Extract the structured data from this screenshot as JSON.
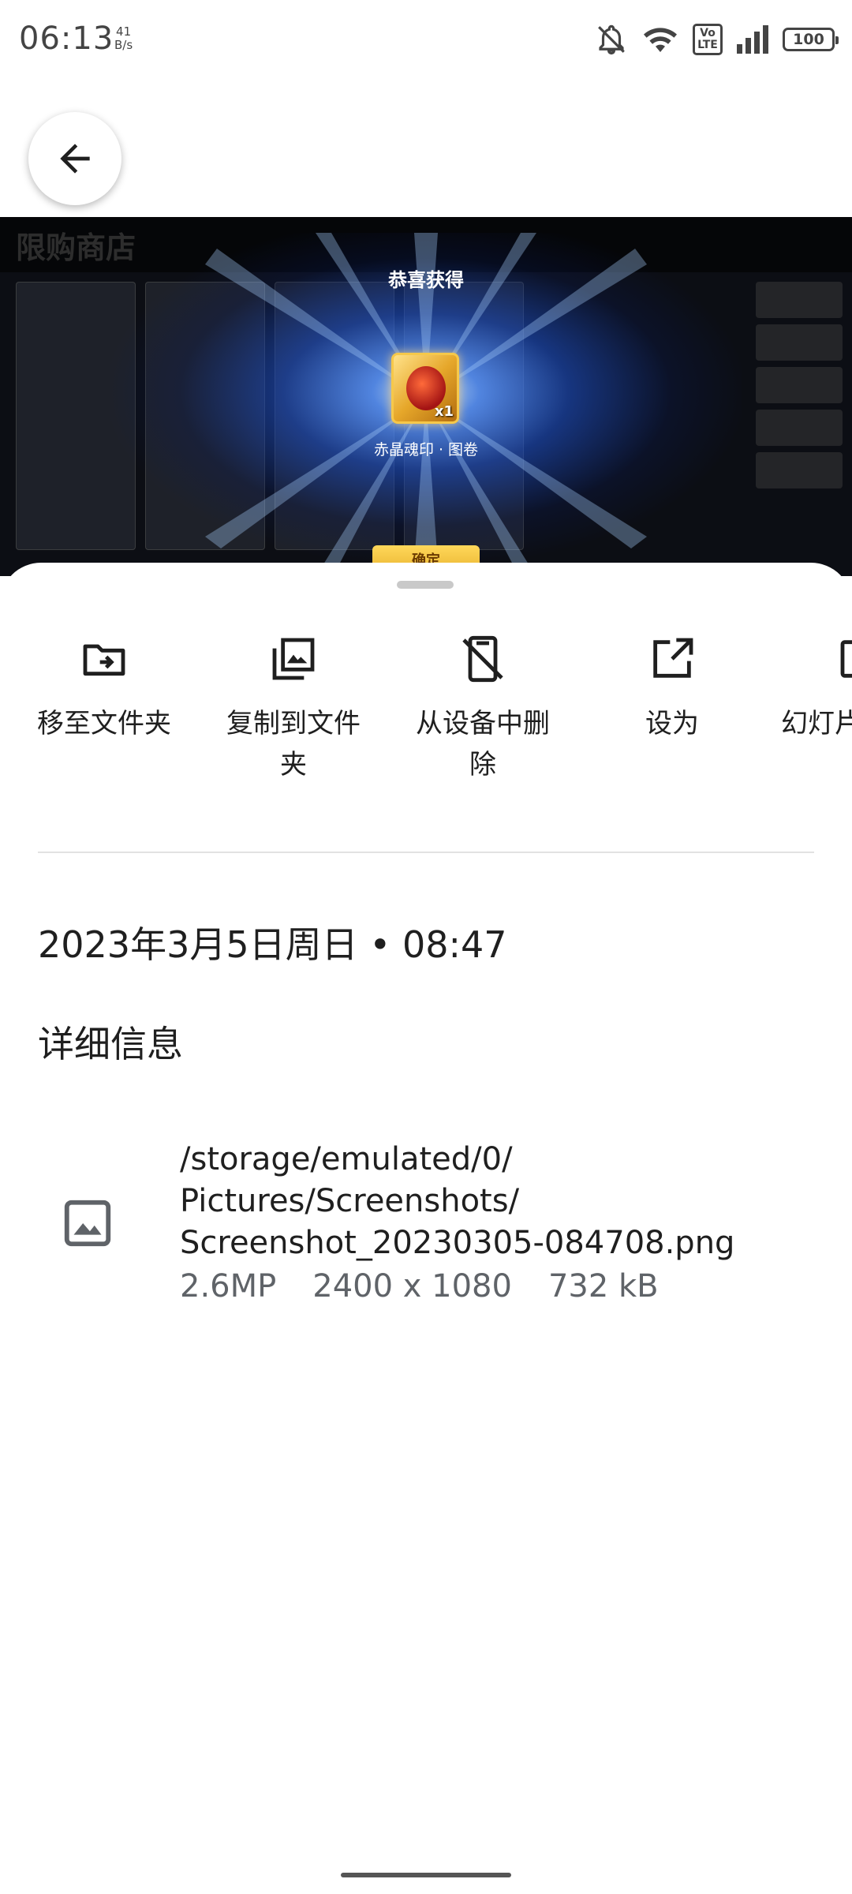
{
  "status_bar": {
    "time": "06:13",
    "net_speed_value": "41",
    "net_speed_unit": "B/s",
    "icons": [
      "bell-off-icon",
      "wifi-icon",
      "volte-icon",
      "signal-icon",
      "battery-icon"
    ],
    "volte_label_top": "Vo",
    "volte_label_bottom": "LTE",
    "battery": "100"
  },
  "preview": {
    "shop_title": "限购商店",
    "popup_title": "恭喜获得",
    "item_count": "x1",
    "item_name": "赤晶魂印 · 图卷",
    "confirm_label": "确定"
  },
  "actions": [
    {
      "label": "移至文件夹",
      "icon": "move-to-folder-icon"
    },
    {
      "label": "复制到文件夹",
      "icon": "copy-to-folder-icon"
    },
    {
      "label": "从设备中删除",
      "icon": "delete-from-device-icon"
    },
    {
      "label": "设为",
      "icon": "set-as-icon"
    },
    {
      "label": "幻灯片",
      "icon": "slideshow-icon"
    }
  ],
  "date_time": "2023年3月5日周日 • 08:47",
  "details": {
    "title": "详细信息",
    "path_line1": "/storage/emulated/0/",
    "path_line2": "Pictures/Screenshots/",
    "path_line3": "Screenshot_20230305-084708.png",
    "megapixels": "2.6MP",
    "resolution": "2400 x 1080",
    "size": "732 kB"
  },
  "colors": {
    "text_primary": "#1f1f1f",
    "text_secondary": "#5f6368",
    "divider": "#e2e2e2"
  }
}
